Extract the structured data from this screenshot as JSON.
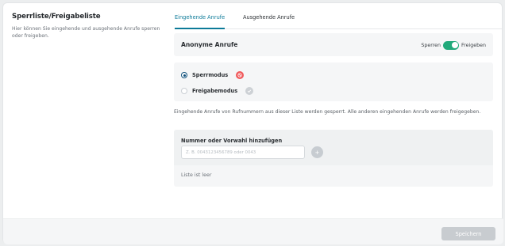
{
  "section": {
    "title": "Sperrliste/Freigabeliste",
    "description": "Hier können Sie eingehende und ausgehende Anrufe sperren oder freigeben."
  },
  "tabs": [
    {
      "label": "Eingehende Anrufe",
      "active": true
    },
    {
      "label": "Ausgehende Anrufe",
      "active": false
    }
  ],
  "anonymous": {
    "label": "Anonyme Anrufe",
    "toggle_left": "Sperren",
    "toggle_right": "Freigeben",
    "toggle_on": true
  },
  "modes": [
    {
      "label": "Sperrmodus",
      "selected": true,
      "icon": "block-icon"
    },
    {
      "label": "Freigabemodus",
      "selected": false,
      "icon": "check-icon"
    }
  ],
  "info_text": "Eingehende Anrufe von Rufnummern aus dieser Liste werden gesperrt. Alle anderen eingehenden Anrufe werden freigegeben.",
  "add_number": {
    "label": "Nummer oder Vorwahl hinzufügen",
    "placeholder": "Z. B. 0043123456789 oder 0043",
    "value": "",
    "button_symbol": "+"
  },
  "list_empty_text": "Liste ist leer",
  "footer": {
    "save_label": "Speichern"
  },
  "colors": {
    "accent": "#0c7a98",
    "toggle_on": "#21a97a",
    "block_badge": "#f0595b",
    "disabled": "#c8ccd0"
  }
}
